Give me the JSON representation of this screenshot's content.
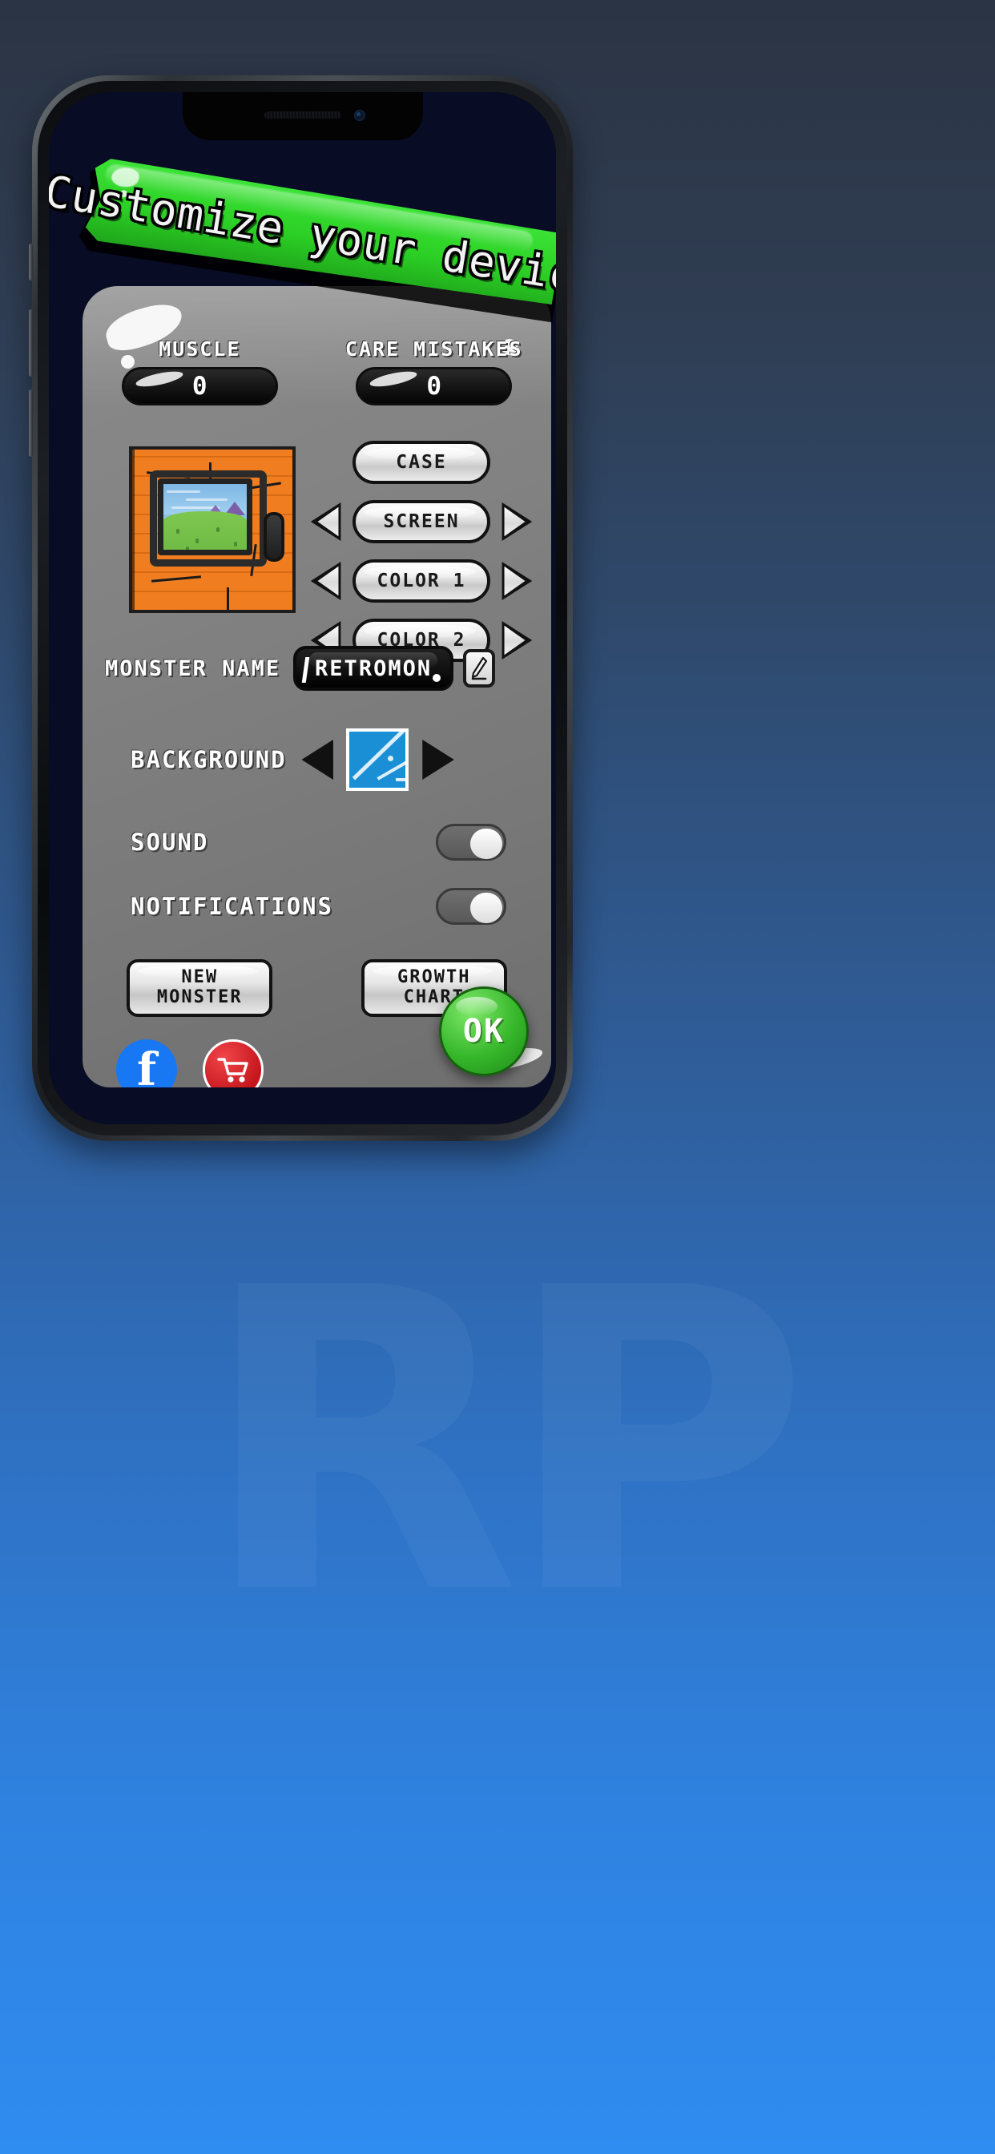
{
  "banner": {
    "text": "Customize your device",
    "color": "#2ccf25"
  },
  "stats": [
    {
      "label": "MUSCLE",
      "value": "0"
    },
    {
      "label": "CARE MISTAKES",
      "value": "0"
    }
  ],
  "customize_buttons": [
    {
      "label": "CASE",
      "has_arrows": false
    },
    {
      "label": "SCREEN",
      "has_arrows": true
    },
    {
      "label": "COLOR 1",
      "has_arrows": true
    },
    {
      "label": "COLOR 2",
      "has_arrows": true
    }
  ],
  "monster_name": {
    "label": "MONSTER NAME",
    "value": "RETROMON",
    "edit_icon": "pencil-icon"
  },
  "background": {
    "label": "BACKGROUND",
    "prev_icon": "arrow-left-icon",
    "next_icon": "arrow-right-icon",
    "thumbnail_color": "#1a8fd6"
  },
  "toggles": [
    {
      "label": "SOUND",
      "state": "off"
    },
    {
      "label": "NOTIFICATIONS",
      "state": "off"
    }
  ],
  "action_buttons": [
    {
      "line1": "NEW",
      "line2": "MONSTER"
    },
    {
      "line1": "GROWTH",
      "line2": "CHART"
    }
  ],
  "social": [
    {
      "name": "facebook-icon",
      "glyph": "f",
      "color": "#1877f2"
    },
    {
      "name": "shop-cart-icon",
      "glyph": "🛒",
      "color": "#c5161c"
    }
  ],
  "confirm": {
    "label": "OK",
    "color": "#36b72a"
  },
  "device_preview": {
    "case_color": "#f07e20",
    "screen_sky": "#8cc2e8",
    "screen_ground": "#7ec850"
  },
  "watermark": "RP"
}
